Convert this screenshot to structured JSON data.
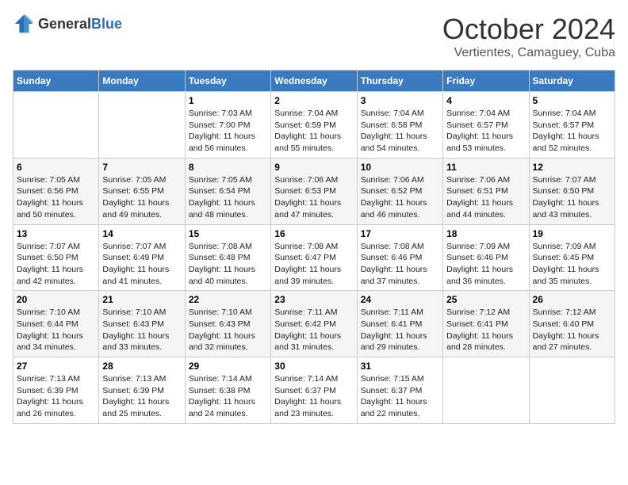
{
  "logo": {
    "general": "General",
    "blue": "Blue"
  },
  "header": {
    "month": "October 2024",
    "location": "Vertientes, Camaguey, Cuba"
  },
  "weekdays": [
    "Sunday",
    "Monday",
    "Tuesday",
    "Wednesday",
    "Thursday",
    "Friday",
    "Saturday"
  ],
  "weeks": [
    [
      {
        "day": "",
        "text": ""
      },
      {
        "day": "",
        "text": ""
      },
      {
        "day": "1",
        "text": "Sunrise: 7:03 AM\nSunset: 7:00 PM\nDaylight: 11 hours and 56 minutes."
      },
      {
        "day": "2",
        "text": "Sunrise: 7:04 AM\nSunset: 6:59 PM\nDaylight: 11 hours and 55 minutes."
      },
      {
        "day": "3",
        "text": "Sunrise: 7:04 AM\nSunset: 6:58 PM\nDaylight: 11 hours and 54 minutes."
      },
      {
        "day": "4",
        "text": "Sunrise: 7:04 AM\nSunset: 6:57 PM\nDaylight: 11 hours and 53 minutes."
      },
      {
        "day": "5",
        "text": "Sunrise: 7:04 AM\nSunset: 6:57 PM\nDaylight: 11 hours and 52 minutes."
      }
    ],
    [
      {
        "day": "6",
        "text": "Sunrise: 7:05 AM\nSunset: 6:56 PM\nDaylight: 11 hours and 50 minutes."
      },
      {
        "day": "7",
        "text": "Sunrise: 7:05 AM\nSunset: 6:55 PM\nDaylight: 11 hours and 49 minutes."
      },
      {
        "day": "8",
        "text": "Sunrise: 7:05 AM\nSunset: 6:54 PM\nDaylight: 11 hours and 48 minutes."
      },
      {
        "day": "9",
        "text": "Sunrise: 7:06 AM\nSunset: 6:53 PM\nDaylight: 11 hours and 47 minutes."
      },
      {
        "day": "10",
        "text": "Sunrise: 7:06 AM\nSunset: 6:52 PM\nDaylight: 11 hours and 46 minutes."
      },
      {
        "day": "11",
        "text": "Sunrise: 7:06 AM\nSunset: 6:51 PM\nDaylight: 11 hours and 44 minutes."
      },
      {
        "day": "12",
        "text": "Sunrise: 7:07 AM\nSunset: 6:50 PM\nDaylight: 11 hours and 43 minutes."
      }
    ],
    [
      {
        "day": "13",
        "text": "Sunrise: 7:07 AM\nSunset: 6:50 PM\nDaylight: 11 hours and 42 minutes."
      },
      {
        "day": "14",
        "text": "Sunrise: 7:07 AM\nSunset: 6:49 PM\nDaylight: 11 hours and 41 minutes."
      },
      {
        "day": "15",
        "text": "Sunrise: 7:08 AM\nSunset: 6:48 PM\nDaylight: 11 hours and 40 minutes."
      },
      {
        "day": "16",
        "text": "Sunrise: 7:08 AM\nSunset: 6:47 PM\nDaylight: 11 hours and 39 minutes."
      },
      {
        "day": "17",
        "text": "Sunrise: 7:08 AM\nSunset: 6:46 PM\nDaylight: 11 hours and 37 minutes."
      },
      {
        "day": "18",
        "text": "Sunrise: 7:09 AM\nSunset: 6:46 PM\nDaylight: 11 hours and 36 minutes."
      },
      {
        "day": "19",
        "text": "Sunrise: 7:09 AM\nSunset: 6:45 PM\nDaylight: 11 hours and 35 minutes."
      }
    ],
    [
      {
        "day": "20",
        "text": "Sunrise: 7:10 AM\nSunset: 6:44 PM\nDaylight: 11 hours and 34 minutes."
      },
      {
        "day": "21",
        "text": "Sunrise: 7:10 AM\nSunset: 6:43 PM\nDaylight: 11 hours and 33 minutes."
      },
      {
        "day": "22",
        "text": "Sunrise: 7:10 AM\nSunset: 6:43 PM\nDaylight: 11 hours and 32 minutes."
      },
      {
        "day": "23",
        "text": "Sunrise: 7:11 AM\nSunset: 6:42 PM\nDaylight: 11 hours and 31 minutes."
      },
      {
        "day": "24",
        "text": "Sunrise: 7:11 AM\nSunset: 6:41 PM\nDaylight: 11 hours and 29 minutes."
      },
      {
        "day": "25",
        "text": "Sunrise: 7:12 AM\nSunset: 6:41 PM\nDaylight: 11 hours and 28 minutes."
      },
      {
        "day": "26",
        "text": "Sunrise: 7:12 AM\nSunset: 6:40 PM\nDaylight: 11 hours and 27 minutes."
      }
    ],
    [
      {
        "day": "27",
        "text": "Sunrise: 7:13 AM\nSunset: 6:39 PM\nDaylight: 11 hours and 26 minutes."
      },
      {
        "day": "28",
        "text": "Sunrise: 7:13 AM\nSunset: 6:39 PM\nDaylight: 11 hours and 25 minutes."
      },
      {
        "day": "29",
        "text": "Sunrise: 7:14 AM\nSunset: 6:38 PM\nDaylight: 11 hours and 24 minutes."
      },
      {
        "day": "30",
        "text": "Sunrise: 7:14 AM\nSunset: 6:37 PM\nDaylight: 11 hours and 23 minutes."
      },
      {
        "day": "31",
        "text": "Sunrise: 7:15 AM\nSunset: 6:37 PM\nDaylight: 11 hours and 22 minutes."
      },
      {
        "day": "",
        "text": ""
      },
      {
        "day": "",
        "text": ""
      }
    ]
  ]
}
